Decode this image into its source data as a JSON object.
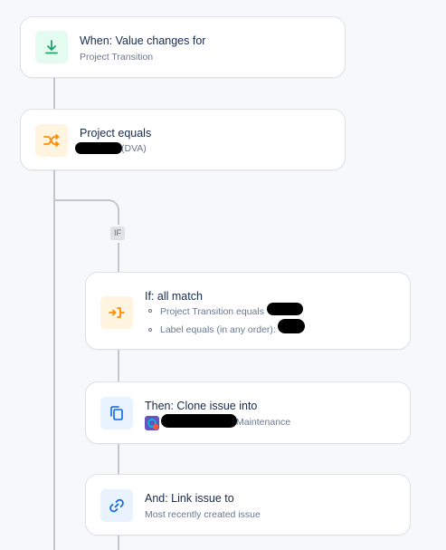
{
  "flow": {
    "trigger": {
      "title": "When: Value changes for",
      "subtitle": "Project Transition",
      "icon": "download-arrow-icon",
      "icon_color": "#36b37e",
      "icon_bg": "#e3fcef"
    },
    "condition": {
      "title": "Project equals",
      "subtitle_suffix": "(DVA)",
      "icon": "shuffle-icon",
      "icon_color": "#ff8b00",
      "icon_bg": "#fff4e0"
    },
    "branch_badge": "IF",
    "if_block": {
      "title": "If: all match",
      "items": [
        "Project Transition equals",
        "Label equals (in any order):"
      ],
      "icon": "branch-icon",
      "icon_color": "#ff8b00",
      "icon_bg": "#fff4e0"
    },
    "then_block": {
      "title": "Then: Clone issue into",
      "subtitle_suffix": "Maintenance",
      "icon": "copy-icon",
      "icon_color": "#0052cc",
      "icon_bg": "#e9f2ff"
    },
    "and_block": {
      "title": "And: Link issue to",
      "subtitle": "Most recently created issue",
      "icon": "link-icon",
      "icon_color": "#0052cc",
      "icon_bg": "#e9f2ff"
    }
  }
}
